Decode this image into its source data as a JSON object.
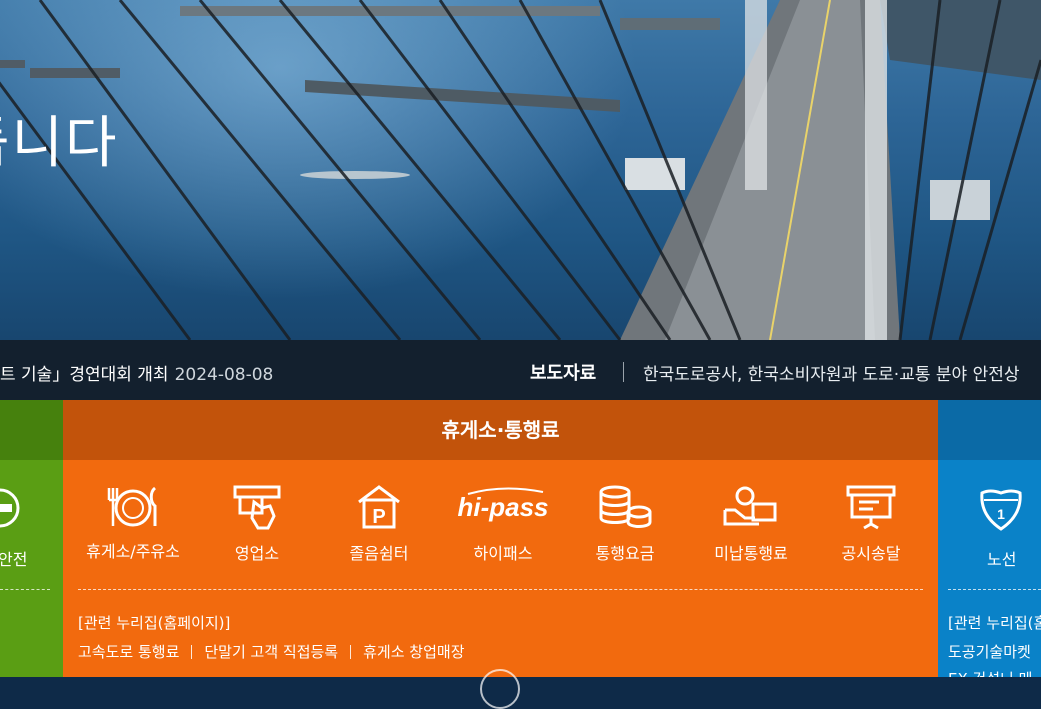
{
  "hero": {
    "title": "듭니다",
    "colors": {
      "sea": "#2d6596",
      "bridge": "#6e747a"
    }
  },
  "ticker": {
    "left_text": "트 기술」경연대회 개최",
    "left_date": "2024-08-08",
    "label": "보도자료",
    "right_text": "한국도로공사, 한국소비자원과 도로·교통 분야 안전상"
  },
  "panels": {
    "green": {
      "item_label": "안전",
      "icon": "minus-circle-icon",
      "color": "#5a9e14"
    },
    "orange": {
      "title": "휴게소·통행료",
      "color": "#f26a0e",
      "items": [
        {
          "label": "휴게소/주유소",
          "icon": "plate-fork-knife-icon"
        },
        {
          "label": "영업소",
          "icon": "toll-booth-hand-icon"
        },
        {
          "label": "졸음쉼터",
          "icon": "parking-house-icon"
        },
        {
          "label": "하이패스",
          "icon": "hipass-logo-icon",
          "logo_text": "hi-pass"
        },
        {
          "label": "통행요금",
          "icon": "coins-icon"
        },
        {
          "label": "미납통행료",
          "icon": "hand-money-icon"
        },
        {
          "label": "공시송달",
          "icon": "notice-board-icon"
        }
      ],
      "related_title": "[관련 누리집(홈페이지)]",
      "links": [
        "고속도로 통행료",
        "단말기 고객 직접등록",
        "휴게소 창업매장"
      ]
    },
    "blue": {
      "item_label": "노선",
      "icon": "route-shield-icon",
      "shield_number": "1",
      "related_title": "[관련 누리집(홈",
      "links": [
        "도공기술마켓",
        "EX-건설니 메"
      ],
      "color": "#0a82c8"
    }
  }
}
